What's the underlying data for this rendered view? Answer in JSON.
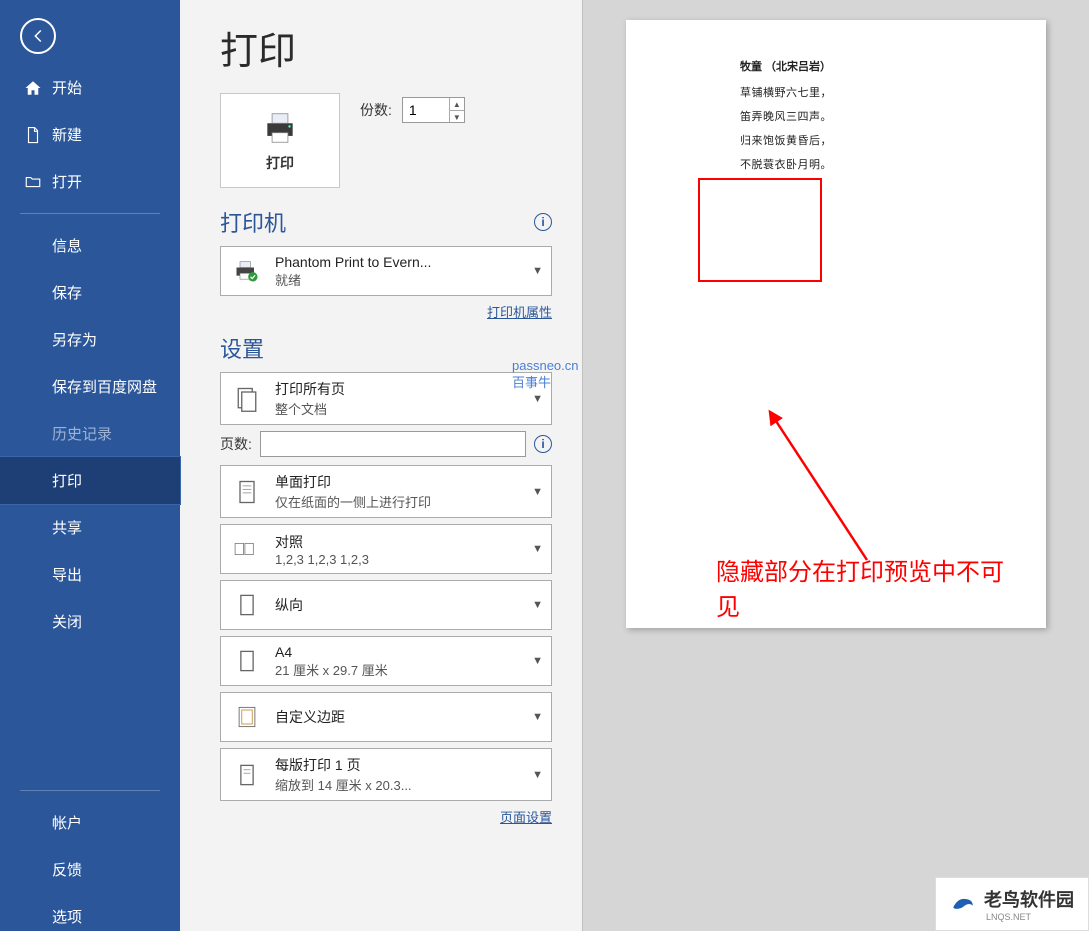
{
  "page_title": "打印",
  "back_icon": "back-arrow-icon",
  "sidebar": {
    "items": [
      {
        "label": "开始",
        "icon": "home"
      },
      {
        "label": "新建",
        "icon": "file"
      },
      {
        "label": "打开",
        "icon": "folder"
      }
    ],
    "sub_items": [
      {
        "label": "信息"
      },
      {
        "label": "保存"
      },
      {
        "label": "另存为"
      },
      {
        "label": "保存到百度网盘"
      },
      {
        "label": "历史记录",
        "dimmed": true
      },
      {
        "label": "打印",
        "active": true
      },
      {
        "label": "共享"
      },
      {
        "label": "导出"
      },
      {
        "label": "关闭"
      }
    ],
    "bottom_items": [
      {
        "label": "帐户"
      },
      {
        "label": "反馈"
      },
      {
        "label": "选项"
      }
    ]
  },
  "print_button": {
    "label": "打印"
  },
  "copies": {
    "label": "份数:",
    "value": "1"
  },
  "printer_section": {
    "heading": "打印机",
    "name": "Phantom Print to Evern...",
    "status": "就绪",
    "properties_link": "打印机属性"
  },
  "settings_section": {
    "heading": "设置",
    "print_range": {
      "line1": "打印所有页",
      "line2": "整个文档"
    },
    "pages_label": "页数:",
    "pages_value": "",
    "duplex": {
      "line1": "单面打印",
      "line2": "仅在纸面的一侧上进行打印"
    },
    "collate": {
      "line1": "对照",
      "line2": "1,2,3    1,2,3    1,2,3"
    },
    "orientation": {
      "line1": "纵向"
    },
    "paper": {
      "line1": "A4",
      "line2": "21 厘米 x 29.7 厘米"
    },
    "margins": {
      "line1": "自定义边距"
    },
    "sheets": {
      "line1": "每版打印 1 页",
      "line2": "缩放到 14 厘米 x 20.3..."
    },
    "page_setup_link": "页面设置"
  },
  "preview": {
    "title": "牧童  （北宋吕岩）",
    "lines": [
      "草铺横野六七里，",
      "笛弄晚风三四声。",
      "归来饱饭黄昏后，",
      "不脱蓑衣卧月明。"
    ]
  },
  "annotation": {
    "text": "隐藏部分在打印预览中不可见"
  },
  "watermark": {
    "line1": "passneo.cn",
    "line2": "百事牛"
  },
  "logo": {
    "text": "老鸟软件园",
    "sub": "LNQS.NET"
  }
}
